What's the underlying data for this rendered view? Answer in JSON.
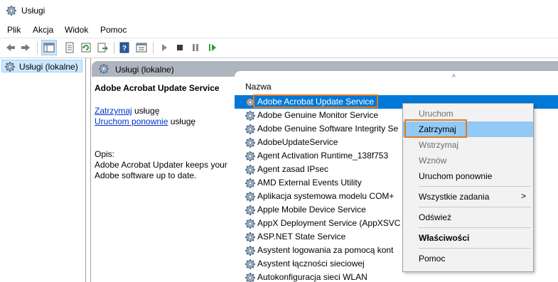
{
  "window": {
    "title": "Usługi"
  },
  "menu": [
    "Plik",
    "Akcja",
    "Widok",
    "Pomoc"
  ],
  "toolbar": {
    "icons": [
      "back-icon",
      "forward-icon",
      "console-tree-icon",
      "properties-icon",
      "refresh-icon",
      "export-icon",
      "help-icon",
      "view-icon",
      "start-icon",
      "stop-icon",
      "pause-icon",
      "resume-icon"
    ]
  },
  "tree": {
    "selected": "Usługi (lokalne)"
  },
  "header": {
    "title": "Usługi (lokalne)"
  },
  "details": {
    "service_name": "Adobe Acrobat Update Service",
    "stop_link": "Zatrzymaj",
    "stop_suffix": " usługę",
    "restart_link": "Uruchom ponownie",
    "restart_suffix": " usługę",
    "desc_label": "Opis:",
    "desc_text": "Adobe Acrobat Updater keeps your Adobe software up to date."
  },
  "list": {
    "column_name": "Nazwa",
    "sort_caret": "^",
    "rows": [
      "Adobe Acrobat Update Service",
      "Adobe Genuine Monitor Service",
      "Adobe Genuine Software Integrity Se",
      "AdobeUpdateService",
      "Agent Activation Runtime_138f753",
      "Agent zasad IPsec",
      "AMD External Events Utility",
      "Aplikacja systemowa modelu COM+",
      "Apple Mobile Device Service",
      "AppX Deployment Service (AppXSVC",
      "ASP.NET State Service",
      "Asystent logowania za pomocą kont",
      "Asystent łączności sieciowej",
      "Autokonfiguracja sieci WLAN"
    ]
  },
  "context_menu": {
    "start": "Uruchom",
    "stop": "Zatrzymaj",
    "pause": "Wstrzymaj",
    "resume": "Wznów",
    "restart": "Uruchom ponownie",
    "all_tasks": "Wszystkie zadania",
    "all_tasks_arrow": ">",
    "refresh": "Odśwież",
    "properties": "Właściwości",
    "help": "Pomoc"
  },
  "colors": {
    "selection": "#0078d7",
    "highlight_outline": "#e07b20",
    "link": "#0033cc"
  }
}
